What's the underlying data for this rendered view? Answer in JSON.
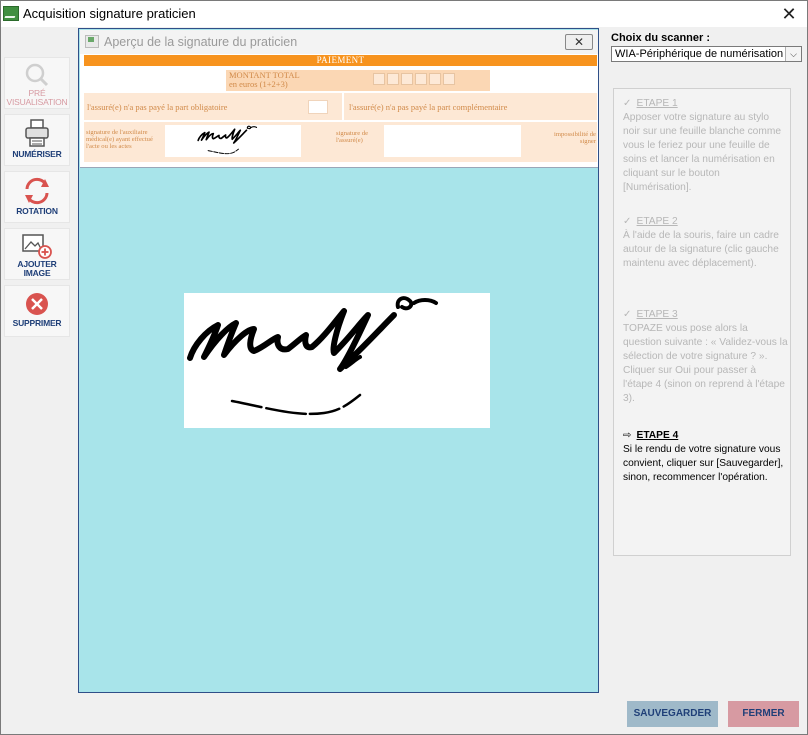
{
  "window": {
    "title": "Acquisition signature praticien"
  },
  "toolbar": {
    "items": [
      {
        "label_line1": "PRÉ",
        "label_line2": "VISUALISATION",
        "icon": "magnifier-icon",
        "enabled": false
      },
      {
        "label_line1": "NUMÉRISER",
        "label_line2": "",
        "icon": "scanner-icon",
        "enabled": true
      },
      {
        "label_line1": "ROTATION",
        "label_line2": "",
        "icon": "rotate-icon",
        "enabled": true
      },
      {
        "label_line1": "AJOUTER",
        "label_line2": "IMAGE",
        "icon": "add-image-icon",
        "enabled": true
      },
      {
        "label_line1": "SUPPRIMER",
        "label_line2": "",
        "icon": "delete-icon",
        "enabled": true
      }
    ]
  },
  "preview": {
    "title": "Aperçu de la signature du praticien",
    "close_glyph": "✕",
    "form": {
      "header": "PAIEMENT",
      "montant_line1": "MONTANT TOTAL",
      "montant_line2": "en euros (1+2+3)",
      "obligatoire": "l'assuré(e) n'a pas payé la part obligatoire",
      "complementaire": "l'assuré(e) n'a pas payé la part complémentaire",
      "sig_auxiliaire": "signature de l'auxiliaire médical(e) ayant effectué l'acte ou les actes",
      "sig_assure": "signature de l'assuré(e)",
      "impossibilite": "impossibilité de signer"
    }
  },
  "scanner": {
    "label": "Choix du scanner :",
    "selected": "WIA-Périphérique de numérisation"
  },
  "steps": [
    {
      "check": "✓",
      "title": "ETAPE 1",
      "text": "Apposer votre signature au stylo noir sur une feuille blanche comme vous le feriez pour une feuille de soins et lancer la numérisation en cliquant sur le bouton [Numérisation].",
      "state": "done"
    },
    {
      "check": "✓",
      "title": "ETAPE 2",
      "text": "À l'aide de la souris, faire un cadre autour de la signature (clic gauche maintenu avec déplacement).",
      "state": "done"
    },
    {
      "check": "✓",
      "title": "ETAPE 3",
      "text": "TOPAZE vous pose alors la question suivante : « Validez-vous la sélection de votre signature ? ». Cliquer sur Oui pour passer à l'étape 4 (sinon on reprend à l'étape 3).",
      "state": "done"
    },
    {
      "check": "⇨",
      "title": "ETAPE 4",
      "text": "Si le rendu de votre signature vous convient, cliquer sur [Sauvegarder], sinon, recommencer l'opération.",
      "state": "current"
    }
  ],
  "buttons": {
    "save": "SAUVEGARDER",
    "close": "FERMER"
  },
  "colors": {
    "accent_orange": "#f7931e",
    "preview_bg": "#a8e4ea",
    "save_btn": "#9fb9c9",
    "close_btn": "#d79aa2",
    "label_blue": "#1f3f78"
  }
}
